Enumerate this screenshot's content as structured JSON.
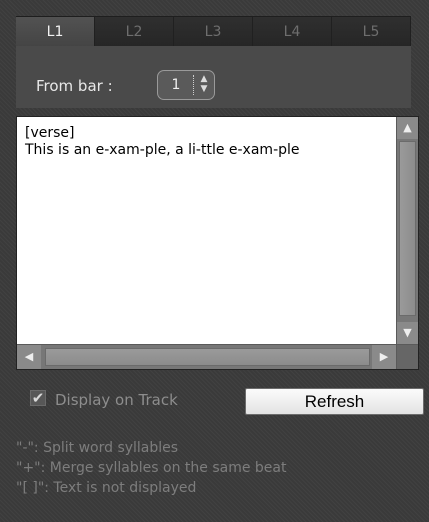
{
  "tabs": [
    {
      "label": "L1",
      "active": true
    },
    {
      "label": "L2",
      "active": false
    },
    {
      "label": "L3",
      "active": false
    },
    {
      "label": "L4",
      "active": false
    },
    {
      "label": "L5",
      "active": false
    }
  ],
  "from_bar": {
    "label": "From bar :",
    "value": "1"
  },
  "editor": {
    "text": "[verse]\nThis is an e-xam-ple, a li-ttle e-xam-ple"
  },
  "display_on_track": {
    "label": "Display on Track",
    "checked": true
  },
  "refresh_button": {
    "label": "Refresh"
  },
  "help": {
    "line1": "\"-\": Split word syllables",
    "line2": "\"+\": Merge syllables on the same beat",
    "line3": "\"[ ]\": Text is not displayed"
  },
  "icons": {
    "spin": "spin-up-down-icon",
    "scroll_up": "arrow-up-icon",
    "scroll_down": "arrow-down-icon",
    "scroll_left": "arrow-left-icon",
    "scroll_right": "arrow-right-icon",
    "check": "checkmark-icon"
  }
}
